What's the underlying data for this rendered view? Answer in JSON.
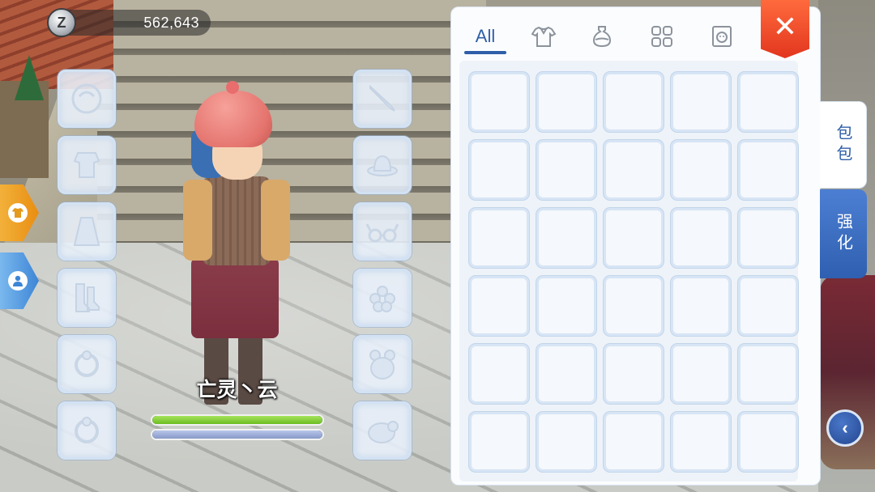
{
  "currency": {
    "icon": "zeny-coin-icon",
    "value": "562,643"
  },
  "side_tabs": [
    {
      "name": "equipment-tab",
      "icon": "shirt-icon",
      "color": "#f0a22a"
    },
    {
      "name": "character-tab",
      "icon": "person-icon",
      "color": "#3d85d6"
    }
  ],
  "equipment_slots": {
    "left": [
      "shield-slot-icon",
      "armor-slot-icon",
      "garment-slot-icon",
      "shoes-slot-icon",
      "accessory-slot-icon",
      "accessory-slot-icon"
    ],
    "right": [
      "weapon-slot-icon",
      "head-top-slot-icon",
      "head-mid-slot-icon",
      "head-low-slot-icon",
      "pet-slot-icon",
      "mount-slot-icon"
    ]
  },
  "character": {
    "name": "亡灵丶云",
    "hp_fraction": 1.0,
    "sp_fraction": 1.0
  },
  "inventory": {
    "tabs": [
      {
        "label": "All",
        "icon": null,
        "active": true
      },
      {
        "label": "",
        "icon": "equipment-shirt-icon",
        "active": false
      },
      {
        "label": "",
        "icon": "potion-icon",
        "active": false
      },
      {
        "label": "",
        "icon": "material-grid-icon",
        "active": false
      },
      {
        "label": "",
        "icon": "card-icon",
        "active": false
      }
    ],
    "slot_count": 30,
    "columns": 5
  },
  "close_button": {
    "symbol": "✕"
  },
  "vertical_tabs": [
    {
      "label": "包包",
      "active": true
    },
    {
      "label": "强化",
      "active": false
    }
  ],
  "back_button": {
    "symbol": "‹"
  },
  "colors": {
    "accent": "#2f5fa8",
    "close": "#e9472a",
    "hp": "#7cc832",
    "sp": "#8d9ecf"
  }
}
